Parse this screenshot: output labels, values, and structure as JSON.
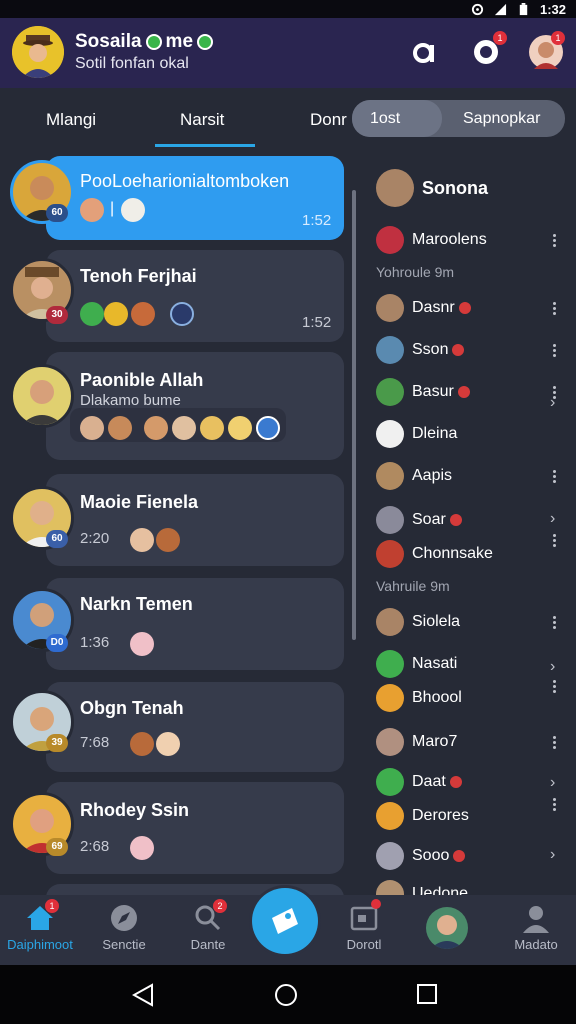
{
  "status_bar": {
    "time": "1:32"
  },
  "header": {
    "title": "Sosaila",
    "title_suffix": "me",
    "subtitle": "Sotil fonfan okal",
    "notif_badge": "1"
  },
  "tabs": {
    "items": [
      "Mlangi",
      "Narsit",
      "Donr"
    ],
    "pill_items": [
      "1ost",
      "Sapnopkar"
    ]
  },
  "conversations": [
    {
      "name": "PooLoeharionialtomboken",
      "time": "1:52",
      "badge": "60",
      "badge_color": "#2b4f8a"
    },
    {
      "name": "Tenoh Ferjhai",
      "time": "1:52",
      "badge": "30",
      "badge_color": "#b02a3c"
    },
    {
      "name": "Paonible Allah",
      "subtitle": "Dlakamo bume",
      "time": "",
      "badge": "",
      "badge_color": ""
    },
    {
      "name": "Maoie Fienela",
      "time": "2:20",
      "badge": "60",
      "badge_color": "#3a5fa8"
    },
    {
      "name": "Narkn Temen",
      "time": "1:36",
      "badge": "D0",
      "badge_color": "#2f6bd0"
    },
    {
      "name": "Obgn Tenah",
      "time": "7:68",
      "badge": "39",
      "badge_color": "#b88a2a"
    },
    {
      "name": "Rhodey Ssin",
      "time": "2:68",
      "badge": "69",
      "badge_color": "#b88a2a"
    }
  ],
  "contacts": {
    "top": "Sonona",
    "section1": "Yohroule 9m",
    "section2": "Vahruile 9m",
    "items": [
      "Maroolens",
      "Dasnr",
      "Sson",
      "Basur",
      "Dleina",
      "Aapis",
      "Soar",
      "Chonnsake",
      "Siolela",
      "Nasati",
      "Bhoool",
      "Maro7",
      "Daat",
      "Derores",
      "Sooo",
      "Uedone"
    ]
  },
  "bottom_nav": {
    "items": [
      "Daiphimoot",
      "Senctie",
      "Dante",
      "Dorotl",
      "Madato"
    ],
    "search_badge": "2",
    "home_badge": "1"
  },
  "colors": {
    "accent": "#2aa6e6",
    "header": "#2a2550",
    "badge": "#e0303a"
  }
}
